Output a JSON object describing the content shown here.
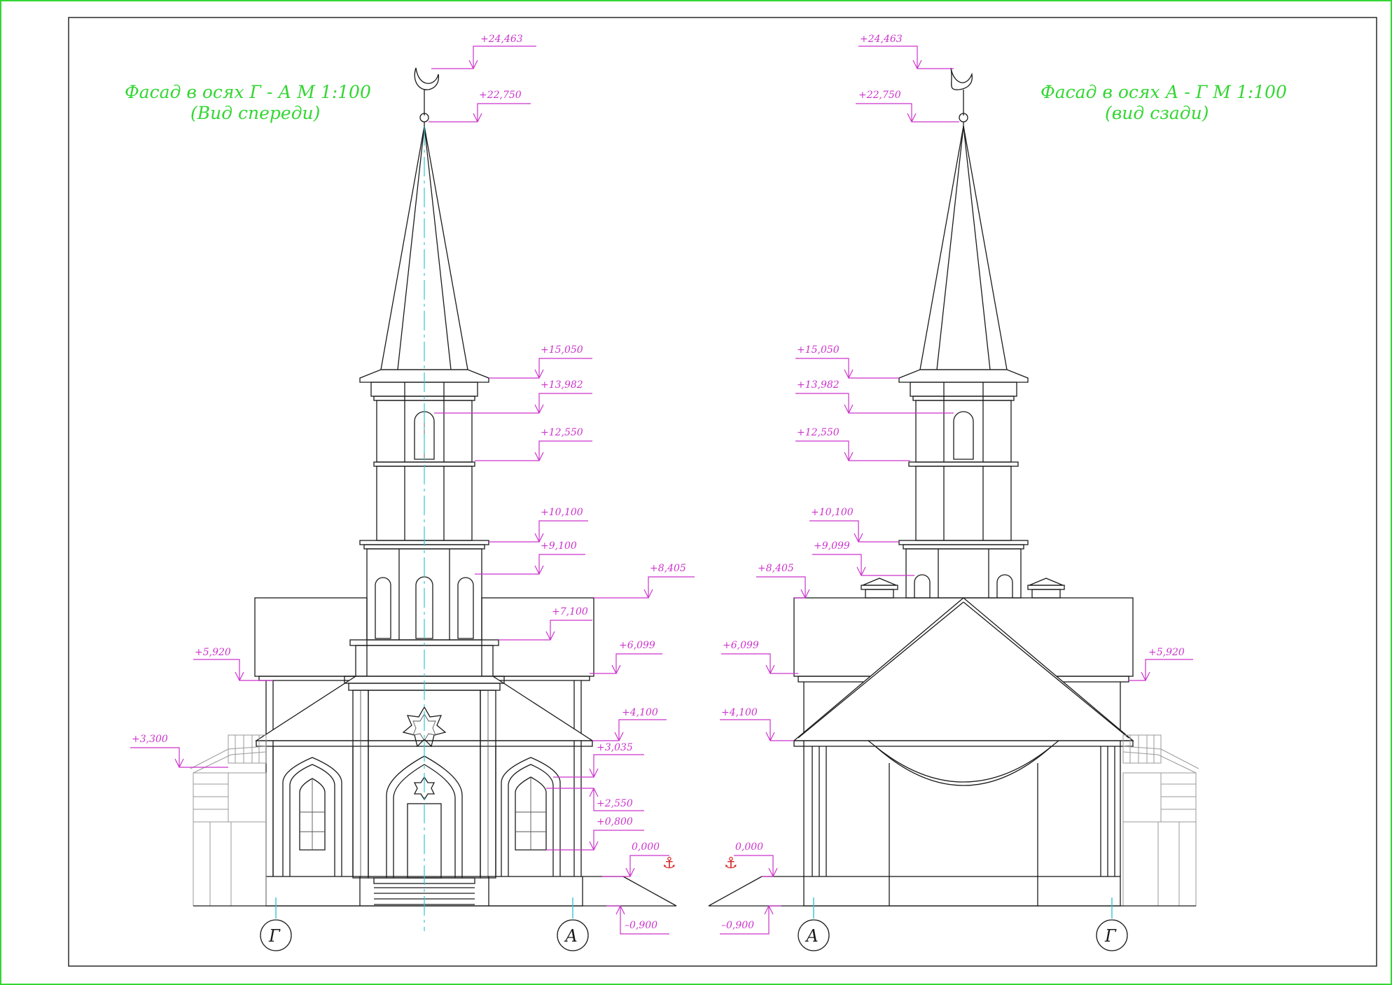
{
  "left_facade": {
    "title": "Фасад в осях Г - А    М  1:100",
    "subtitle": "(Вид спереди)",
    "axes": [
      "Г",
      "А"
    ],
    "marks": {
      "top": "+24,463",
      "finial": "+22,750",
      "spire_base": "+15,050",
      "arch_top": "+13,982",
      "tier2_base": "+12,550",
      "tier1_top": "+10,100",
      "arch1_top": "+9,100",
      "main_roof": "+8,405",
      "tier1_base": "+7,100",
      "eave_right": "+6,099",
      "eave_left": "+5,920",
      "porch_roof": "+4,100",
      "porch_left": "+3,300",
      "door_arch": "+3,035",
      "window_top": "+2,550",
      "sill": "+0,800",
      "zero": "0,000",
      "ground": "–0,900"
    }
  },
  "right_facade": {
    "title": "Фасад в осях А - Г    М  1:100",
    "subtitle": "(вид сзади)",
    "axes": [
      "А",
      "Г"
    ],
    "marks": {
      "top": "+24,463",
      "finial": "+22,750",
      "spire_base": "+15,050",
      "arch_top": "+13,982",
      "tier2_base": "+12,550",
      "tier1_top": "+10,100",
      "arch1_top": "+9,099",
      "main_roof": "+8,405",
      "eave_left": "+6,099",
      "eave_right": "+5,920",
      "gable": "+4,100",
      "zero": "0,000",
      "ground": "–0,900"
    }
  },
  "colors": {
    "lines": "#1a1a1a",
    "dimensions": "#cc33cc",
    "titles": "#33d633",
    "axes": "#33c6d6",
    "anchor": "#d62828",
    "frame": "#33d633"
  },
  "icons": {
    "zero_mark": "anchor-icon"
  }
}
